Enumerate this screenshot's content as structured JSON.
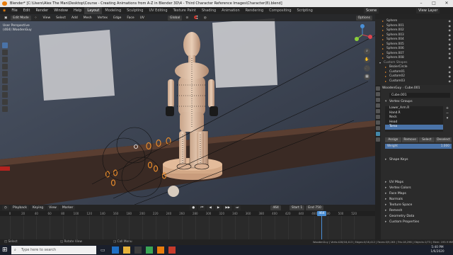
{
  "title_bar": {
    "title": "Blender* [C:\\Users\\Alex The Man\\Desktop\\Course - Creating Animations from A-Z in Blender 3D\\4 - Third Character Reference Images\\Character(8).blend]"
  },
  "menu": {
    "items": [
      "File",
      "Edit",
      "Render",
      "Window",
      "Help"
    ],
    "workspaces": [
      "Layout",
      "Modeling",
      "Sculpting",
      "UV Editing",
      "Texture Paint",
      "Shading",
      "Animation",
      "Rendering",
      "Compositing",
      "Scripting"
    ],
    "active_workspace": "Layout",
    "scene": "Scene",
    "view_layer": "View Layer"
  },
  "viewport": {
    "mode": "Edit Mode",
    "menus": [
      "View",
      "Select",
      "Add",
      "Mesh",
      "Vertex",
      "Edge",
      "Face",
      "UV"
    ],
    "orientation": "Global",
    "overlay_title": "User Perspective",
    "overlay_object": "(464) WoodenGuy",
    "options": "Options"
  },
  "outliner": {
    "rows": [
      {
        "name": "Sphere",
        "ind": 0
      },
      {
        "name": "Sphere.001",
        "ind": 0
      },
      {
        "name": "Sphere.002",
        "ind": 0
      },
      {
        "name": "Sphere.003",
        "ind": 0
      },
      {
        "name": "Sphere.004",
        "ind": 0
      },
      {
        "name": "Sphere.005",
        "ind": 0
      },
      {
        "name": "Sphere.006",
        "ind": 0
      },
      {
        "name": "Sphere.007",
        "ind": 0
      },
      {
        "name": "Sphere.008",
        "ind": 0
      },
      {
        "name": "Custom Shapes",
        "ind": 0
      },
      {
        "name": "BezierCircle",
        "ind": 1
      },
      {
        "name": "Custom01",
        "ind": 1
      },
      {
        "name": "Custom02",
        "ind": 1
      },
      {
        "name": "Custom03",
        "ind": 1
      }
    ]
  },
  "properties": {
    "object": "WoodenGuy",
    "mesh": "Cube.001",
    "mesh_field": "Cube.001",
    "vertex_groups_title": "Vertex Groups",
    "vertex_groups": [
      "Lower_Arm.R",
      "Hand.R",
      "Neck",
      "Head",
      "Torso"
    ],
    "active_group": "Torso",
    "buttons": {
      "assign": "Assign",
      "remove": "Remove",
      "select": "Select",
      "deselect": "Deselect"
    },
    "weight_label": "Weight",
    "weight_value": "1.000",
    "sections": [
      "Shape Keys",
      "UV Maps",
      "Vertex Colors",
      "Face Maps",
      "Normals",
      "Texture Space",
      "Remesh",
      "Geometry Data",
      "Custom Properties"
    ]
  },
  "timeline": {
    "menus": [
      "Playback",
      "Keying",
      "View",
      "Marker"
    ],
    "current_frame": "464",
    "start_label": "Start",
    "start": "1",
    "end_label": "End",
    "end": "750",
    "ticks": [
      "0",
      "20",
      "40",
      "60",
      "80",
      "100",
      "120",
      "140",
      "160",
      "180",
      "200",
      "220",
      "240",
      "260",
      "280",
      "300",
      "320",
      "340",
      "360",
      "380",
      "400",
      "420",
      "440",
      "460",
      "480",
      "500",
      "520"
    ]
  },
  "status": {
    "left": "Select",
    "mid": "Rotate View",
    "right": "Call Menu",
    "stats": "WoodenGuy | Verts:428/18,413 | Edges:0/18,412 | Faces:0/9,263 | Tris:18,298 | Objects:1/73 | Mem: 193.9 MiB | 2.80.75"
  },
  "taskbar": {
    "search": "Type here to search",
    "time": "5:40 PM",
    "date": "1/6/2020"
  },
  "colors": {
    "accent": "#4a8fd6",
    "select": "#e58a2c",
    "outliner_icon": "#e58a2c",
    "mesh_icon": "#8ac"
  }
}
